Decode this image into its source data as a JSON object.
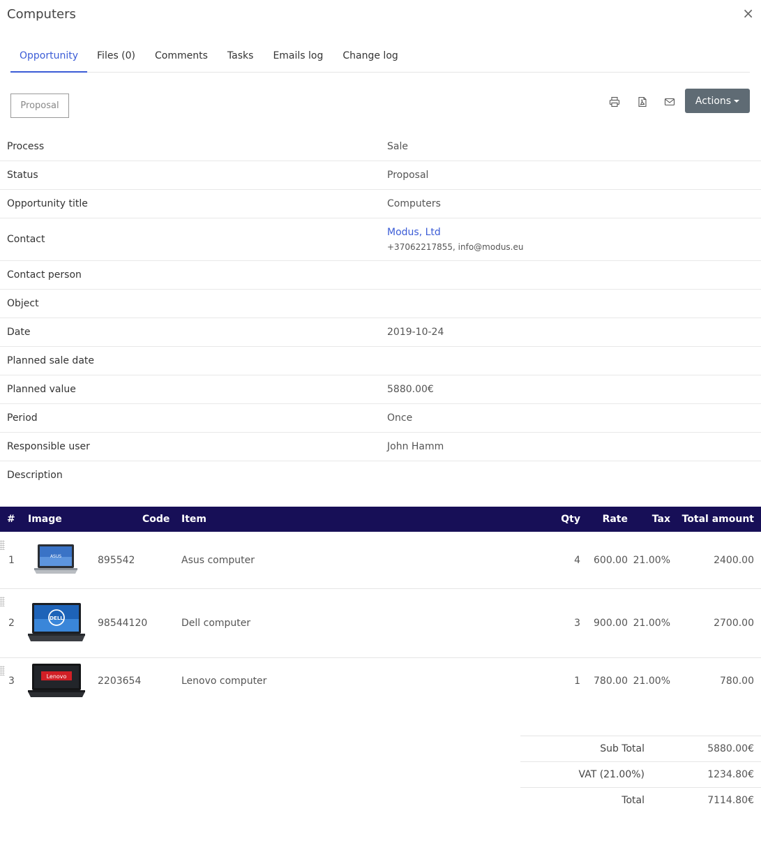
{
  "header": {
    "title": "Computers",
    "close": "×"
  },
  "tabs": [
    {
      "label": "Opportunity"
    },
    {
      "label": "Files (0)"
    },
    {
      "label": "Comments"
    },
    {
      "label": "Tasks"
    },
    {
      "label": "Emails log"
    },
    {
      "label": "Change log"
    }
  ],
  "toolbar": {
    "status": "Proposal",
    "actions": "Actions"
  },
  "icons": {
    "print": "print-icon",
    "pdf": "pdf-icon",
    "email": "email-icon"
  },
  "fields": {
    "process": {
      "label": "Process",
      "value": "Sale"
    },
    "status": {
      "label": "Status",
      "value": "Proposal"
    },
    "title": {
      "label": "Opportunity title",
      "value": "Computers"
    },
    "contact": {
      "label": "Contact",
      "value": "Modus, Ltd",
      "sub": "+37062217855, info@modus.eu"
    },
    "contact_person": {
      "label": "Contact person"
    },
    "object": {
      "label": "Object"
    },
    "date": {
      "label": "Date",
      "value": "2019-10-24"
    },
    "planned_sale_date": {
      "label": "Planned sale date"
    },
    "planned_value": {
      "label": "Planned value",
      "value": "5880.00€"
    },
    "period": {
      "label": "Period",
      "value": "Once"
    },
    "responsible": {
      "label": "Responsible user",
      "value": "John Hamm"
    },
    "description": {
      "label": "Description"
    }
  },
  "items": {
    "headers": {
      "num": "#",
      "image": "Image",
      "code": "Code",
      "item": "Item",
      "qty": "Qty",
      "rate": "Rate",
      "tax": "Tax",
      "total": "Total amount"
    },
    "rows": [
      {
        "num": "1",
        "code": "895542",
        "item": "Asus computer",
        "qty": "4",
        "rate": "600.00",
        "tax": "21.00%",
        "total": "2400.00",
        "brand": "ASUS"
      },
      {
        "num": "2",
        "code": "98544120",
        "item": "Dell computer",
        "qty": "3",
        "rate": "900.00",
        "tax": "21.00%",
        "total": "2700.00",
        "brand": "DELL"
      },
      {
        "num": "3",
        "code": "2203654",
        "item": "Lenovo computer",
        "qty": "1",
        "rate": "780.00",
        "tax": "21.00%",
        "total": "780.00",
        "brand": "Lenovo"
      }
    ]
  },
  "totals": {
    "subtotal": {
      "label": "Sub Total",
      "value": "5880.00€"
    },
    "vat": {
      "label": "VAT (21.00%)",
      "value": "1234.80€"
    },
    "total": {
      "label": "Total",
      "value": "7114.80€"
    }
  },
  "colors": {
    "accent": "#3b5cd6",
    "table_header": "#170f57",
    "actions_bg": "#5f6b74"
  }
}
